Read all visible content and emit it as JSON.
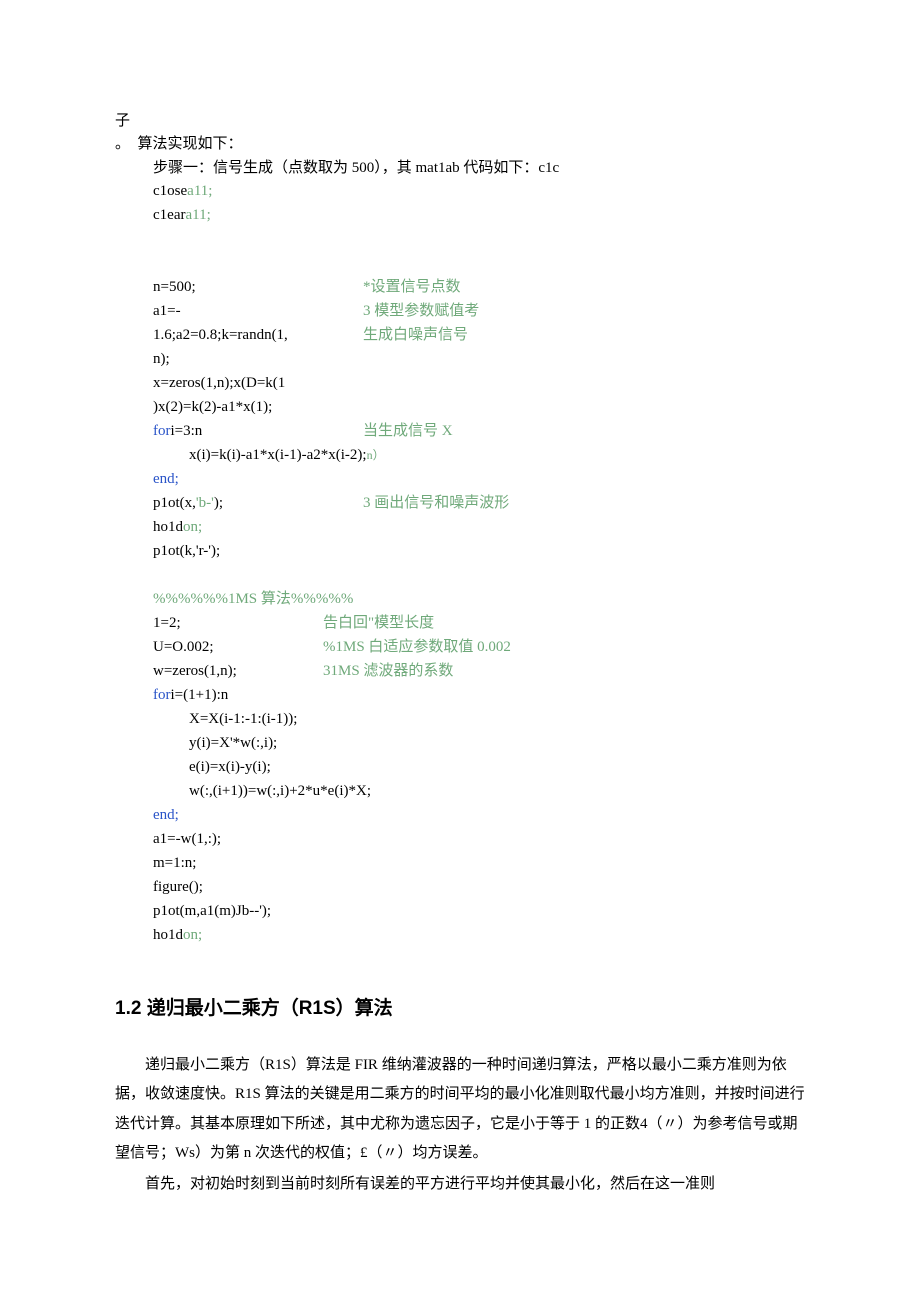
{
  "intro": {
    "line1": "子",
    "line2_prefix": "。　算法实现如下：",
    "step1": "步骤一：信号生成（点数取为 500），其 mat1ab 代码如下：c1c"
  },
  "code": {
    "close": "c1ose",
    "all1": "a11;",
    "clear": "c1ear",
    "all2": "a11;",
    "n_assign": "n=500;",
    "n_comment": "*设置信号点数",
    "a1_assign": "a1=-",
    "a1_comment": "3 模型参数赋值考",
    "a1_cont": "1.6;a2=0.8;k=randn(1,",
    "a1_cont_comment": "生成白噪声信号",
    "n_close": "n);",
    "xzeros": "x=zeros(1,n);x(D=k(1",
    "x2": ")x(2)=k(2)-a1*x(1);",
    "for1": "i=3:n",
    "for1_comment": "当生成信号 X",
    "for1_body": "x(i)=k(i)-a1*x(i-1)-a2*x(i-2);",
    "for1_body_sup": "n）",
    "end1": "end;",
    "plot1_a": "p1ot(x,",
    "plot1_b": "'b-'",
    "plot1_c": ");",
    "plot1_comment": "3 画出信号和噪声波形",
    "hold1_a": "ho1d",
    "hold1_b": "on;",
    "plot2": "p1ot(k,'r-');",
    "lms_header": "%%%%%%1MS 算法%%%%%",
    "l_assign": "1=2;",
    "l_comment": "告白回\"模型长度",
    "u_assign": "U=O.002;",
    "u_comment": "%1MS 白适应参数取值 0.002",
    "w_assign": "w=zeros(1,n);",
    "w_comment": "31MS 滤波器的系数",
    "for2": "i=(1+1):n",
    "for2_l1": "X=X(i-1:-1:(i-1));",
    "for2_l2": "y(i)=X'*w(:,i);",
    "for2_l3": "e(i)=x(i)-y(i);",
    "for2_l4": "w(:,(i+1))=w(:,i)+2*u*e(i)*X;",
    "end2": "end;",
    "a1w": "a1=-w(1,:);",
    "m": "m=1:n;",
    "figure": "figure();",
    "plot3": "p1ot(m,a1(m)Jb--');",
    "hold2_a": "ho1d",
    "hold2_b": "on;"
  },
  "section": {
    "title": "1.2 递归最小二乘方（R1S）算法",
    "para1": "递归最小二乘方（R1S）算法是 FIR 维纳灌波器的一种时间递归算法，严格以最小二乘方准则为依据，收敛速度快。R1S 算法的关键是用二乘方的时间平均的最小化准则取代最小均方准则，并按时间进行迭代计算。其基本原理如下所述，其中尤称为遗忘因子，它是小于等于 1 的正数4（〃）为参考信号或期望信号；Ws）为第 n 次迭代的权值；£（〃）均方误差。",
    "para2": "首先，对初始时刻到当前时刻所有误差的平方进行平均并使其最小化，然后在这一准则"
  }
}
